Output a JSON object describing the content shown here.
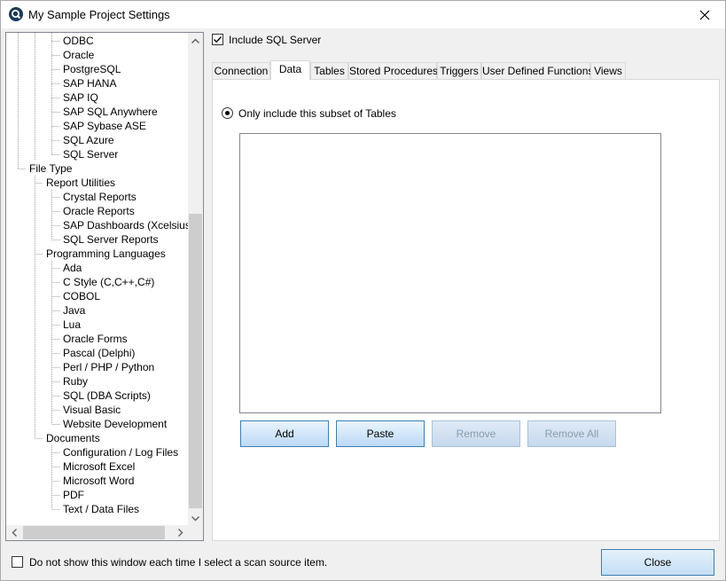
{
  "window": {
    "title": "My Sample Project Settings"
  },
  "tree": {
    "items": [
      {
        "label": "ODBC",
        "level": 3
      },
      {
        "label": "Oracle",
        "level": 3
      },
      {
        "label": "PostgreSQL",
        "level": 3
      },
      {
        "label": "SAP HANA",
        "level": 3
      },
      {
        "label": "SAP IQ",
        "level": 3
      },
      {
        "label": "SAP SQL Anywhere",
        "level": 3
      },
      {
        "label": "SAP Sybase ASE",
        "level": 3
      },
      {
        "label": "SQL Azure",
        "level": 3
      },
      {
        "label": "SQL Server",
        "level": 3
      },
      {
        "label": "File Type",
        "level": 1
      },
      {
        "label": "Report Utilities",
        "level": 2
      },
      {
        "label": "Crystal Reports",
        "level": 3
      },
      {
        "label": "Oracle Reports",
        "level": 3
      },
      {
        "label": "SAP Dashboards (Xcelsius)",
        "level": 3
      },
      {
        "label": "SQL Server Reports",
        "level": 3
      },
      {
        "label": "Programming Languages",
        "level": 2
      },
      {
        "label": "Ada",
        "level": 3
      },
      {
        "label": "C Style (C,C++,C#)",
        "level": 3
      },
      {
        "label": "COBOL",
        "level": 3
      },
      {
        "label": "Java",
        "level": 3
      },
      {
        "label": "Lua",
        "level": 3
      },
      {
        "label": "Oracle Forms",
        "level": 3
      },
      {
        "label": "Pascal (Delphi)",
        "level": 3
      },
      {
        "label": "Perl / PHP / Python",
        "level": 3
      },
      {
        "label": "Ruby",
        "level": 3
      },
      {
        "label": "SQL (DBA Scripts)",
        "level": 3
      },
      {
        "label": "Visual Basic",
        "level": 3
      },
      {
        "label": "Website Development",
        "level": 3
      },
      {
        "label": "Documents",
        "level": 2
      },
      {
        "label": "Configuration / Log Files",
        "level": 3
      },
      {
        "label": "Microsoft Excel",
        "level": 3
      },
      {
        "label": "Microsoft Word",
        "level": 3
      },
      {
        "label": "PDF",
        "level": 3
      },
      {
        "label": "Text / Data Files",
        "level": 3
      }
    ]
  },
  "include": {
    "label": "Include SQL Server",
    "checked": true
  },
  "tabs": [
    {
      "label": "Connection"
    },
    {
      "label": "Data",
      "active": true
    },
    {
      "label": "Tables"
    },
    {
      "label": "Stored Procedures"
    },
    {
      "label": "Triggers"
    },
    {
      "label": "User Defined Functions"
    },
    {
      "label": "Views"
    }
  ],
  "data_tab": {
    "radio_label": "Only include this subset of Tables",
    "radio_selected": true,
    "buttons": {
      "add": "Add",
      "paste": "Paste",
      "remove": "Remove",
      "remove_all": "Remove All"
    }
  },
  "footer": {
    "dont_show_label": "Do not show this window each time I select a scan source item.",
    "dont_show_checked": false,
    "close_label": "Close"
  },
  "icons": {
    "app": "search-icon",
    "close": "close-icon",
    "check": "checkmark-icon",
    "scroll_up": "chevron-up-icon",
    "scroll_down": "chevron-down-icon",
    "scroll_left": "chevron-left-icon",
    "scroll_right": "chevron-right-icon"
  }
}
